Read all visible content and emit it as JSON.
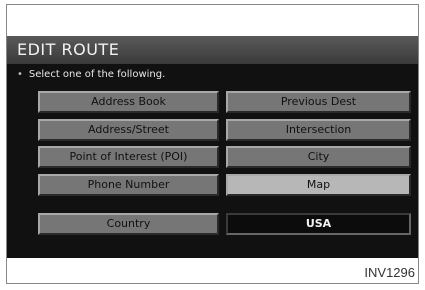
{
  "screen": {
    "title": "EDIT ROUTE",
    "instruction": "Select one of the following.",
    "buttons": {
      "address_book": "Address Book",
      "previous_dest": "Previous Dest",
      "address_street": "Address/Street",
      "intersection": "Intersection",
      "poi": "Point of Interest (POI)",
      "city": "City",
      "phone_number": "Phone Number",
      "map": "Map",
      "country": "Country",
      "country_value": "USA"
    }
  },
  "figure_id": "INV1296",
  "colors": {
    "header_bg": "#4a4a4a",
    "button_bg": "#767676",
    "selected_bg": "#b7b7b7",
    "screen_bg": "#111111"
  }
}
